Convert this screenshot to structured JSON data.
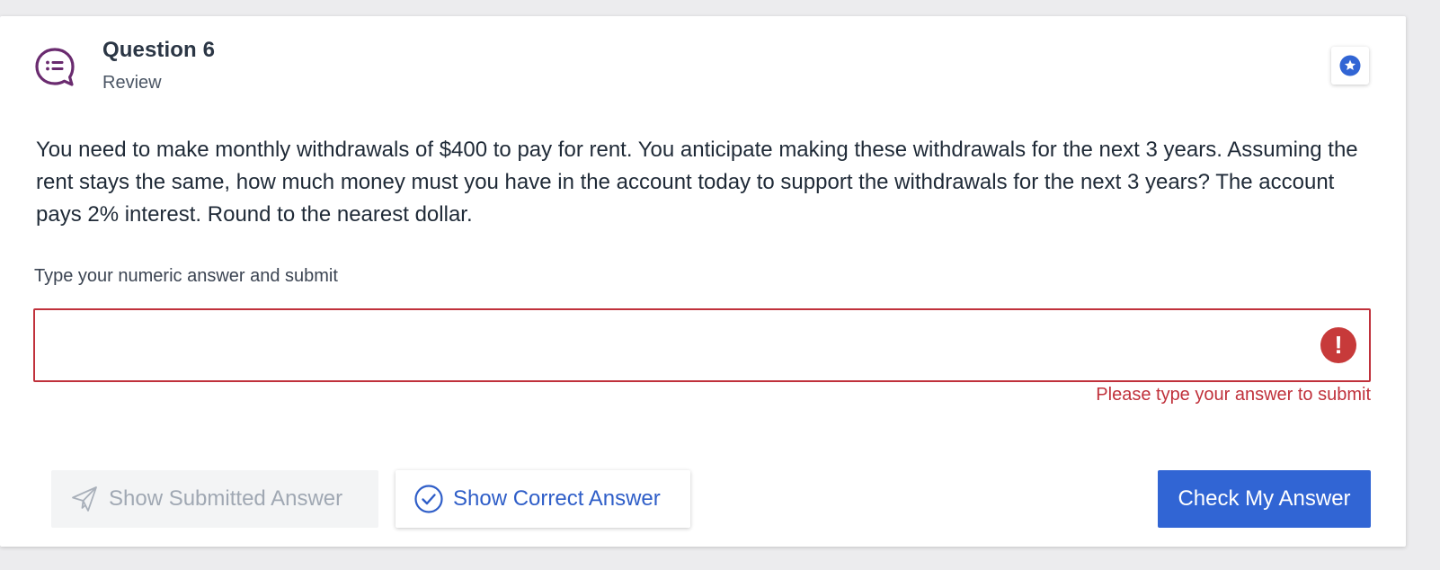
{
  "question": {
    "title": "Question 6",
    "subtitle": "Review",
    "text": "You need to make monthly withdrawals of $400 to pay for rent. You anticipate making these withdrawals for the next 3 years. Assuming the rent stays the same, how much money must you have in the account today to support the withdrawals for the next 3 years? The account pays 2% interest. Round to the nearest dollar.",
    "icon": "chat-list-icon"
  },
  "bookmark": {
    "icon": "star-icon"
  },
  "answer": {
    "label": "Type your numeric answer and submit",
    "value": "",
    "placeholder": "",
    "error_icon": "!",
    "error": "Please type your answer to submit"
  },
  "buttons": {
    "show_submitted": "Show Submitted Answer",
    "show_correct": "Show Correct Answer",
    "check": "Check My Answer"
  },
  "colors": {
    "accent": "#3165d4",
    "error": "#c0313b",
    "question_icon": "#6a2b6f"
  }
}
